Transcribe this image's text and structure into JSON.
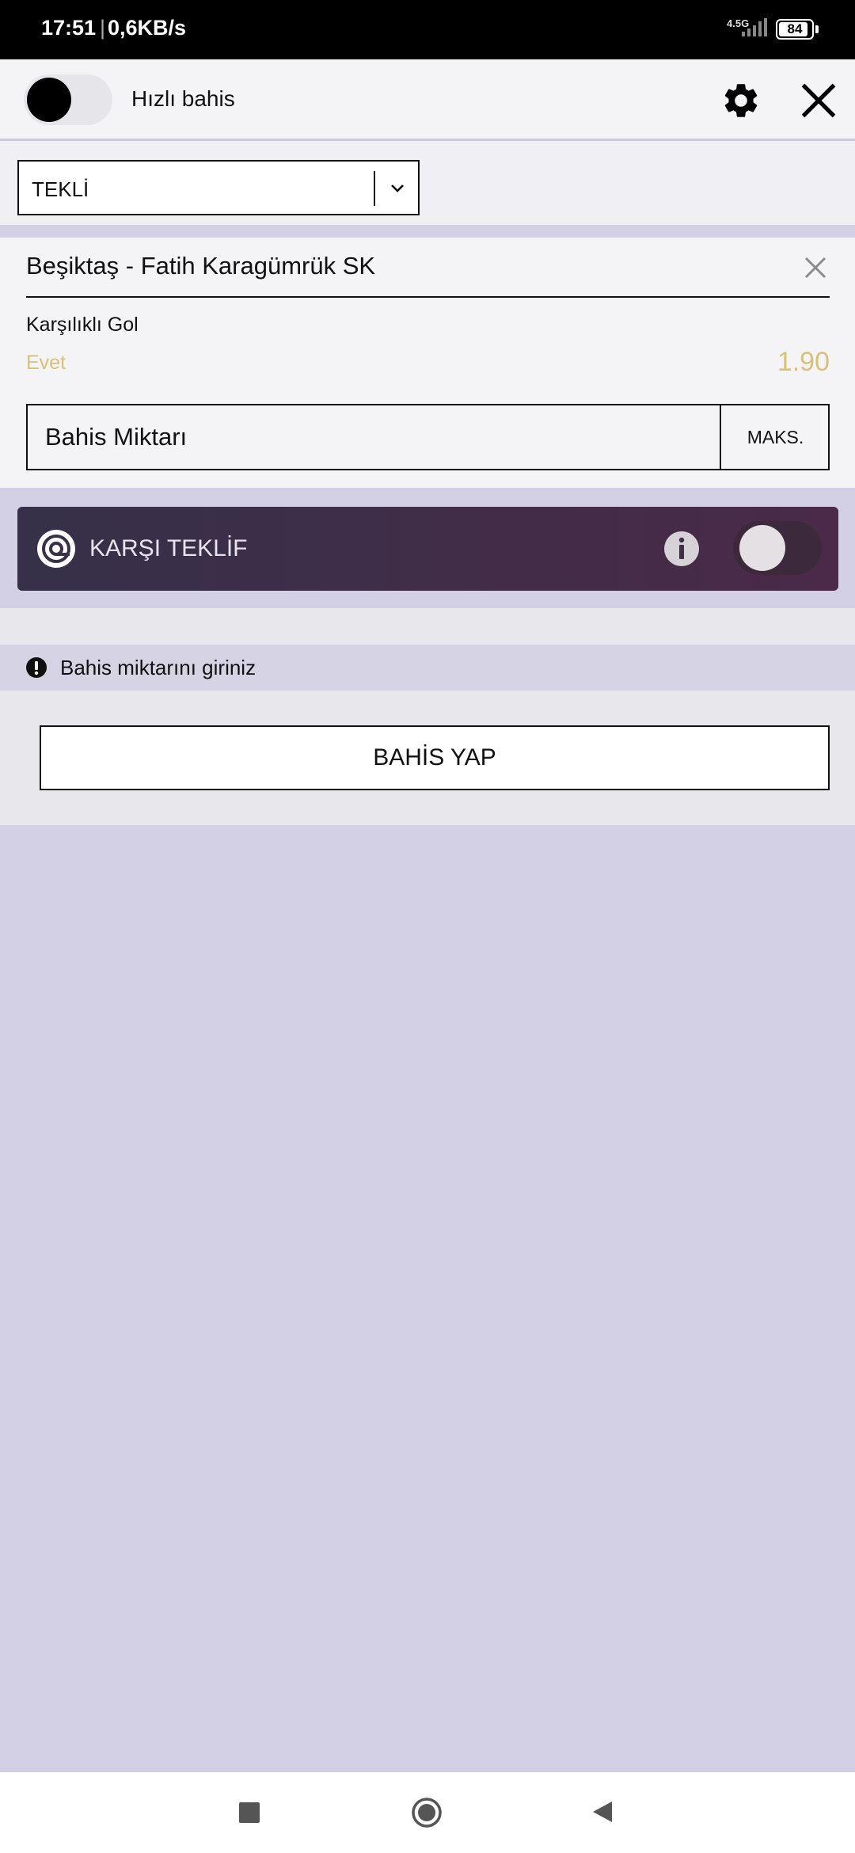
{
  "status_bar": {
    "time": "17:51",
    "separator": "|",
    "speed": "0,6KB/s",
    "network": "4.5G",
    "battery": "84"
  },
  "header": {
    "quick_bet_label": "Hızlı bahis",
    "quick_bet_enabled": false
  },
  "bet_type": {
    "selected": "TEKLİ"
  },
  "bet": {
    "match": "Beşiktaş - Fatih Karagümrük SK",
    "market": "Karşılıklı Gol",
    "selection": "Evet",
    "odds": "1.90",
    "stake_placeholder": "Bahis Miktarı",
    "max_label": "MAKS."
  },
  "counter_offer": {
    "label": "KARŞI TEKLİF",
    "enabled": false
  },
  "warning": {
    "text": "Bahis miktarını giriniz"
  },
  "place_bet": {
    "label": "BAHİS YAP"
  },
  "colors": {
    "accent_gold": "#d8c27a",
    "counter_offer_bg": "#3f2d47",
    "page_bg": "#d3d0e6"
  }
}
